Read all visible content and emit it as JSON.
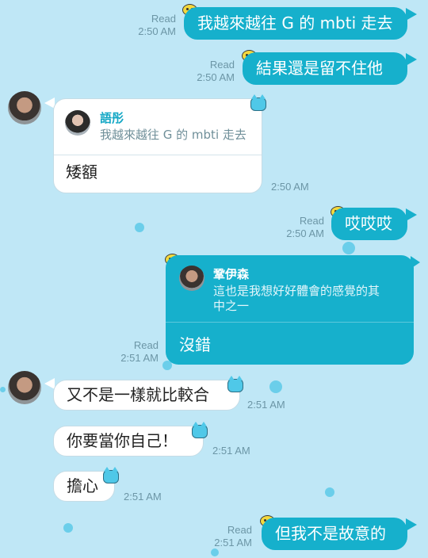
{
  "messages": {
    "m1": {
      "status": "Read",
      "time": "2:50 AM",
      "text": "我越來越往 G 的 mbti 走去"
    },
    "m2": {
      "status": "Read",
      "time": "2:50 AM",
      "text": "結果還是留不住他"
    },
    "m3": {
      "time": "2:50 AM",
      "quote_name": "語彤",
      "quote_text": "我越來越往 G 的 mbti 走去",
      "text": "矮額"
    },
    "m4": {
      "status": "Read",
      "time": "2:50 AM",
      "text": "哎哎哎"
    },
    "m5": {
      "status": "Read",
      "time": "2:51 AM",
      "quote_name": "鞏伊森",
      "quote_text_1": "這也是我想好好體會的感覺的其",
      "quote_text_2": "中之一",
      "text": "沒錯"
    },
    "m6": {
      "time": "2:51 AM",
      "text": "又不是一樣就比較合"
    },
    "m7": {
      "time": "2:51 AM",
      "text": "你要當你自己！"
    },
    "m8": {
      "time": "2:51 AM",
      "text": "擔心"
    },
    "m9": {
      "status": "Read",
      "time": "2:51 AM",
      "text": "但我不是故意的"
    }
  },
  "colors": {
    "background": "#bfe7f6",
    "outgoing": "#16b0cc",
    "incoming": "#ffffff",
    "meta": "#6c96a6"
  },
  "icons": [
    "avatar",
    "yellow-sticker-icon",
    "blue-cat-icon"
  ]
}
